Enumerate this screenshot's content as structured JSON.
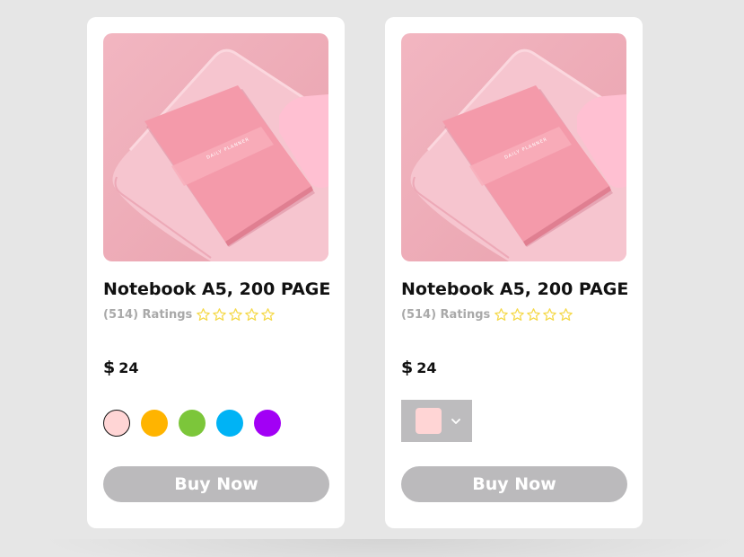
{
  "products": [
    {
      "title": "Notebook A5, 200 PAGE",
      "ratings_text": "(514) Ratings",
      "rating_stars": 5,
      "price_currency": "$",
      "price_value": "24",
      "color_picker": "swatches",
      "colors": [
        "#ffd5d5",
        "#ffb400",
        "#7cc63a",
        "#00b3f5",
        "#a200f5"
      ],
      "selected_color": "#ffd5d5",
      "buy_label": "Buy Now"
    },
    {
      "title": "Notebook A5, 200 PAGE",
      "ratings_text": "(514) Ratings",
      "rating_stars": 5,
      "price_currency": "$",
      "price_value": "24",
      "color_picker": "dropdown",
      "selected_color": "#ffd5d5",
      "buy_label": "Buy Now"
    }
  ],
  "theme": {
    "page_background": "#e6e6e6",
    "card_background": "#ffffff",
    "button_color": "#bbbabc",
    "star_color": "#f5d94a"
  }
}
